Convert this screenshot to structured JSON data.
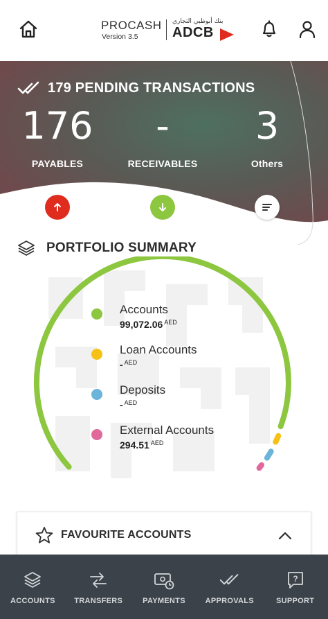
{
  "header": {
    "brand_name": "PROCASH",
    "version": "Version 3.5",
    "bank_arabic": "بنك أبوظبي التجاري",
    "bank_short": "ADCB"
  },
  "pending": {
    "title": "179 PENDING TRANSACTIONS",
    "payables": {
      "value": "176",
      "label": "PAYABLES"
    },
    "receivables": {
      "value": "-",
      "label": "RECEIVABLES"
    },
    "others": {
      "value": "3",
      "label": "Others"
    }
  },
  "portfolio": {
    "title": "PORTFOLIO SUMMARY",
    "items": [
      {
        "label": "Accounts",
        "value": "99,072.06",
        "currency": "AED",
        "color": "#8dc63f"
      },
      {
        "label": "Loan Accounts",
        "value": "-",
        "currency": "AED",
        "color": "#f6c117"
      },
      {
        "label": "Deposits",
        "value": "-",
        "currency": "AED",
        "color": "#6cb4d9"
      },
      {
        "label": "External Accounts",
        "value": "294.51",
        "currency": "AED",
        "color": "#e0689a"
      }
    ]
  },
  "favourites": {
    "title": "FAVOURITE ACCOUNTS"
  },
  "bottom_nav": {
    "items": [
      {
        "label": "ACCOUNTS",
        "icon": "layers-icon"
      },
      {
        "label": "TRANSFERS",
        "icon": "transfer-icon"
      },
      {
        "label": "PAYMENTS",
        "icon": "payments-icon"
      },
      {
        "label": "APPROVALS",
        "icon": "double-check-icon"
      },
      {
        "label": "SUPPORT",
        "icon": "help-icon"
      }
    ]
  },
  "colors": {
    "accent_green": "#8dc63f",
    "alert_red": "#e02b1f",
    "nav_background": "#3b4249"
  }
}
